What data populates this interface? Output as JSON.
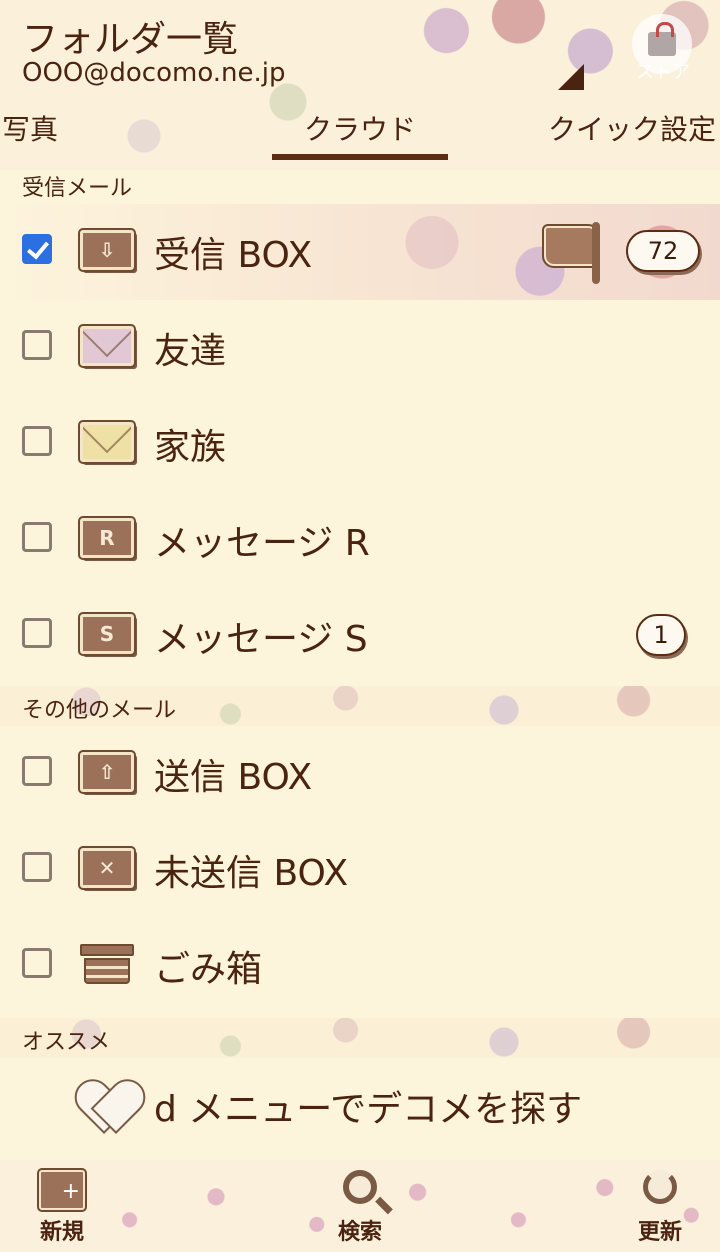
{
  "header": {
    "title": "フォルダ一覧",
    "account": "OOO@docomo.ne.jp",
    "store_label": "ストア"
  },
  "tabs": [
    {
      "label": "写真"
    },
    {
      "label": "クラウド"
    },
    {
      "label": "クイック設定"
    }
  ],
  "sections": {
    "inbox": "受信メール",
    "other": "その他のメール",
    "recommend": "オススメ"
  },
  "inbox_folders": [
    {
      "label": "受信 BOX",
      "checked": true,
      "icon": "inbox-download-icon",
      "unread": "72",
      "flagged": true
    },
    {
      "label": "友達",
      "checked": false,
      "icon": "envelope-pink-icon"
    },
    {
      "label": "家族",
      "checked": false,
      "icon": "envelope-yellow-icon"
    },
    {
      "label": "メッセージ R",
      "checked": false,
      "icon": "message-r-icon",
      "glyph": "R"
    },
    {
      "label": "メッセージ S",
      "checked": false,
      "icon": "message-s-icon",
      "glyph": "S",
      "unread": "1"
    }
  ],
  "other_folders": [
    {
      "label": "送信 BOX",
      "checked": false,
      "icon": "outbox-upload-icon"
    },
    {
      "label": "未送信 BOX",
      "checked": false,
      "icon": "unsent-icon"
    },
    {
      "label": "ごみ箱",
      "checked": false,
      "icon": "trash-icon"
    }
  ],
  "recommend": {
    "label": "d メニューでデコメを探す",
    "icon": "heart-icon"
  },
  "footer": {
    "new_label": "新規",
    "search_label": "検索",
    "refresh_label": "更新"
  },
  "colors": {
    "background": "#fdf4dc",
    "text": "#4a2410",
    "checkbox_checked": "#2b6fe0",
    "icon_brown": "#9b7259"
  }
}
